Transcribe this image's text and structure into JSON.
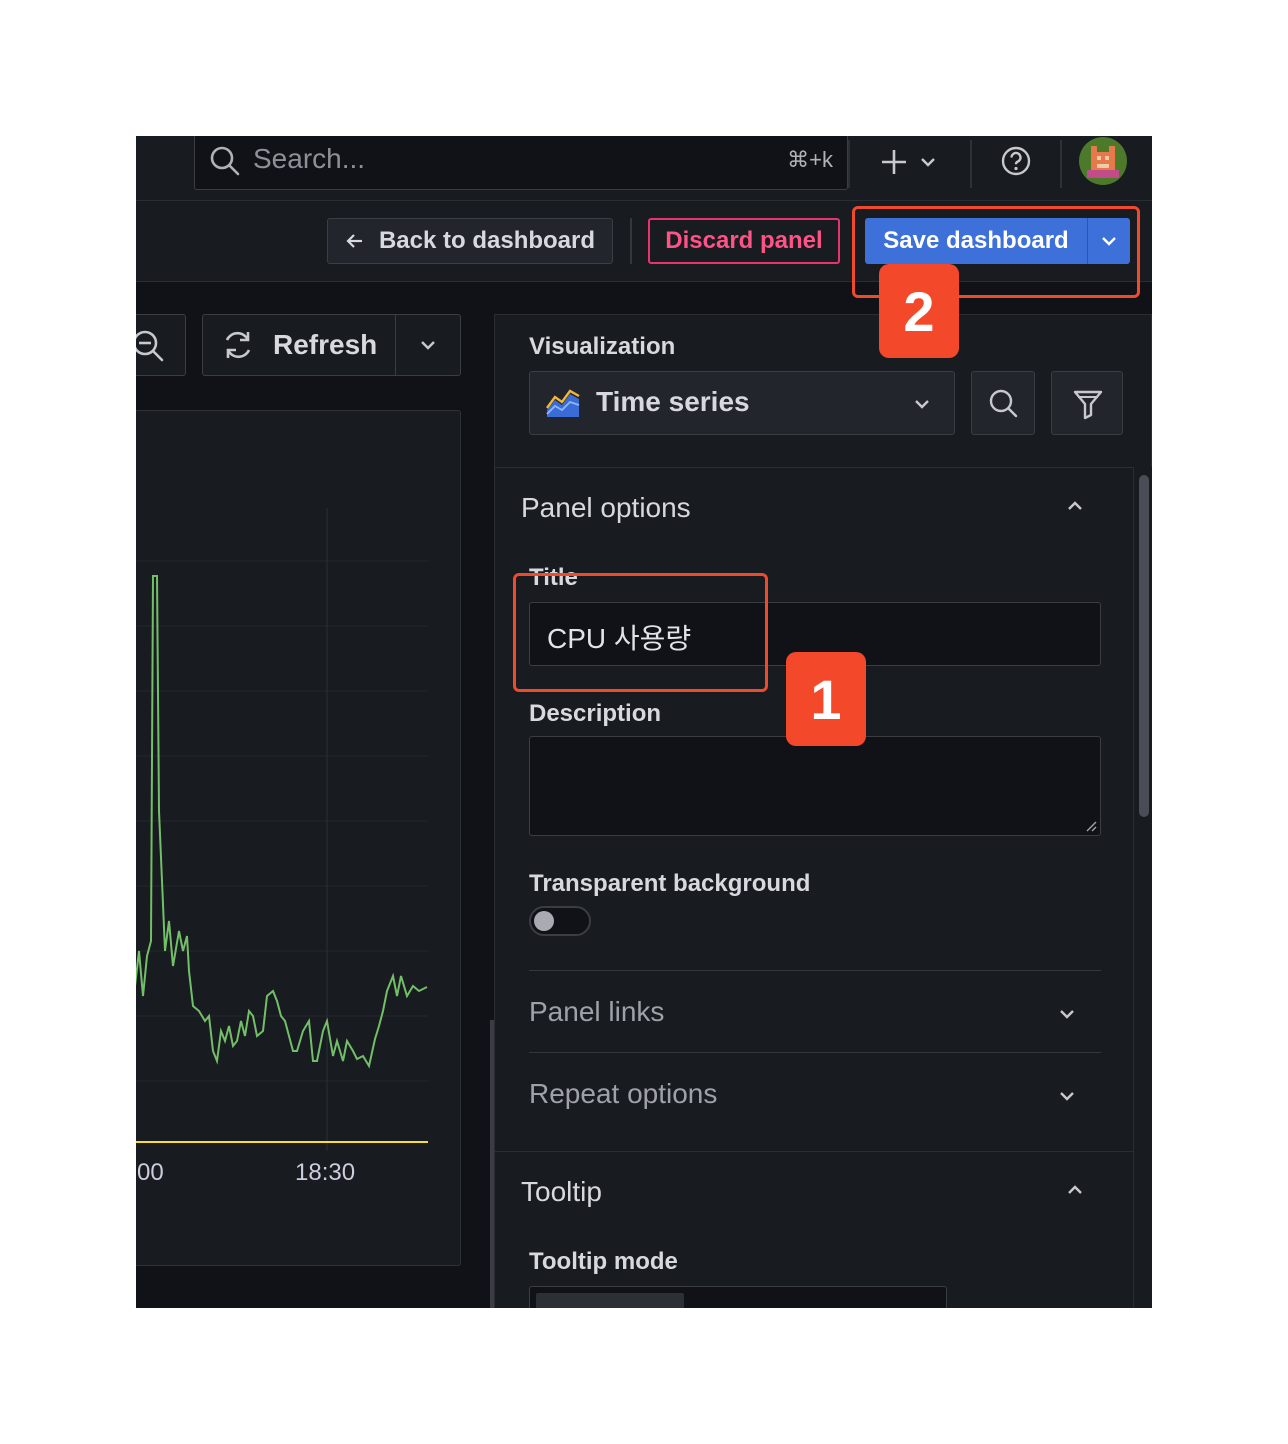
{
  "topbar": {
    "search_placeholder": "Search...",
    "search_shortcut": "⌘+k"
  },
  "toolbar": {
    "back_label": "Back to dashboard",
    "discard_label": "Discard panel",
    "save_label": "Save dashboard"
  },
  "left": {
    "refresh_label": "Refresh",
    "x_ticks": [
      "00",
      "18:30"
    ]
  },
  "options": {
    "visualization_label": "Visualization",
    "visualization_value": "Time series",
    "panel_options_title": "Panel options",
    "title_label": "Title",
    "title_value": "CPU 사용량",
    "description_label": "Description",
    "description_value": "",
    "transparent_label": "Transparent background",
    "transparent_on": false,
    "panel_links_title": "Panel links",
    "repeat_options_title": "Repeat options",
    "tooltip_title": "Tooltip",
    "tooltip_mode_label": "Tooltip mode"
  },
  "annotations": {
    "badge_1": "1",
    "badge_2": "2"
  },
  "colors": {
    "series_green": "#73bf69",
    "threshold_yellow": "#fade2a",
    "accent_blue": "#3d71d9",
    "danger_pink": "#e8336f",
    "annotation_red": "#f04a2c"
  }
}
